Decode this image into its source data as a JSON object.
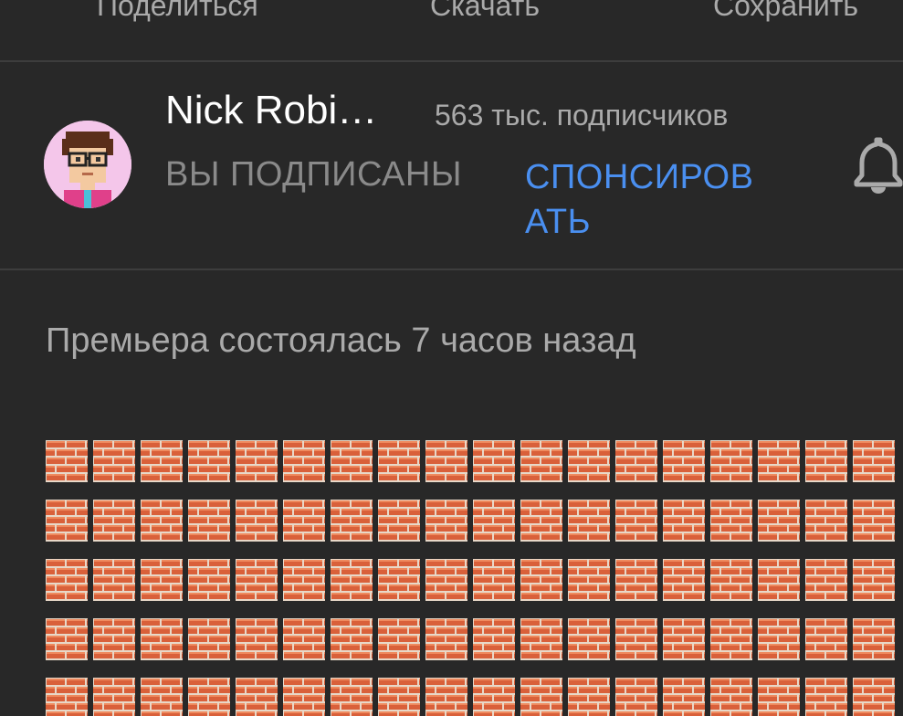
{
  "actions": {
    "share_label": "Поделиться",
    "download_label": "Скачать",
    "save_label": "Сохранить"
  },
  "channel": {
    "name": "Nick Robi…",
    "subscribers": "563 тыс. подписчиков",
    "subscribed_label": "ВЫ ПОДПИСАНЫ",
    "sponsor_label": "СПОНСИРОВАТЬ",
    "avatar_icon": "pixel-avatar-icon",
    "bell_icon": "bell-icon"
  },
  "video": {
    "premiere_text": "Премьера состоялась 7 часов назад"
  },
  "description": {
    "emoji_icon": "brick-emoji",
    "rows": 5,
    "per_row": 18
  },
  "colors": {
    "background": "#282828",
    "accent": "#4a8ff0",
    "brick": "#d9603a"
  }
}
